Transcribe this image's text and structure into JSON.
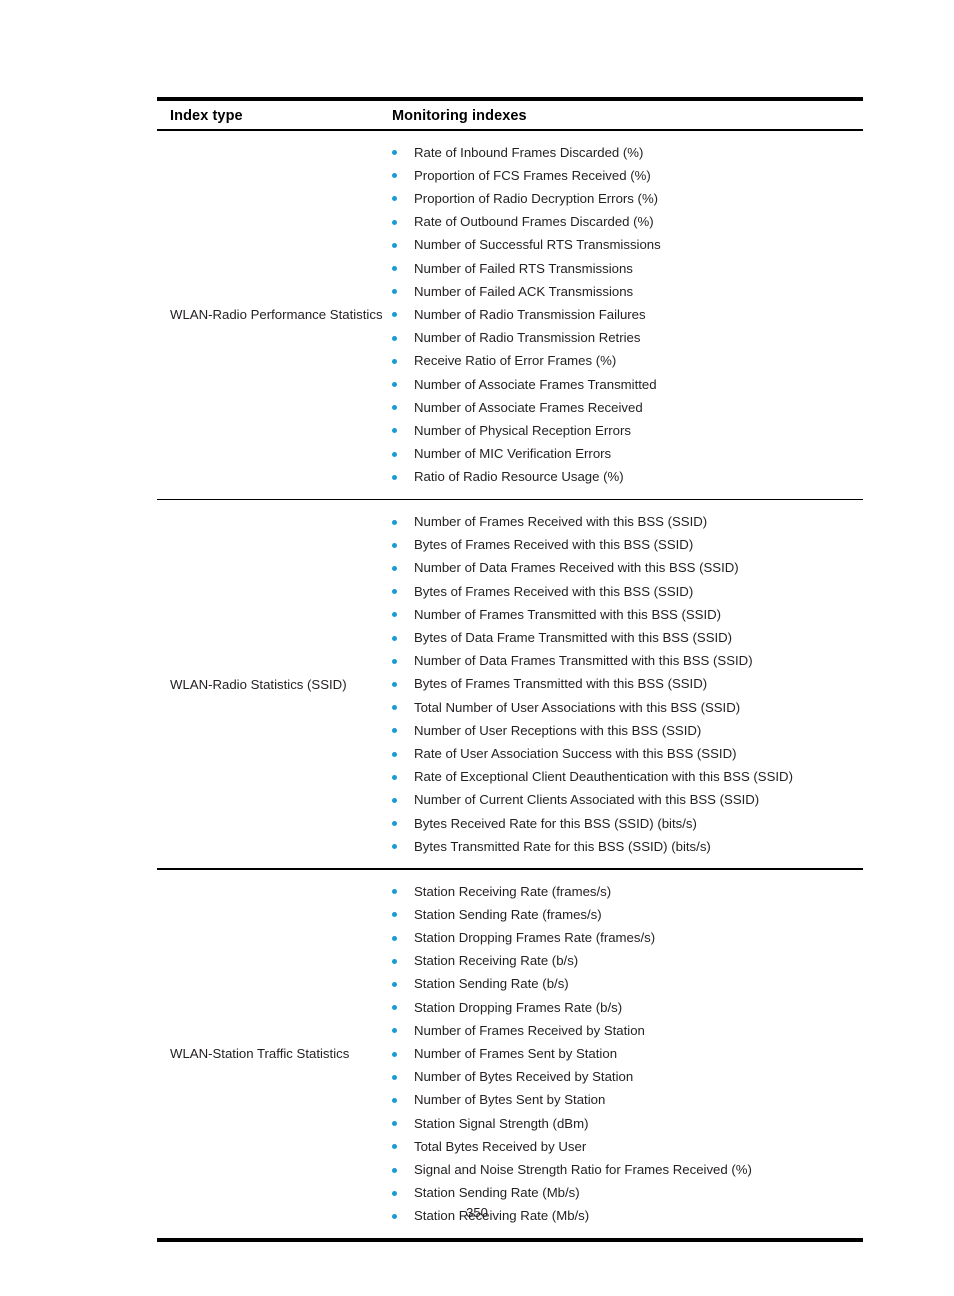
{
  "document": {
    "page_number": "350",
    "bullet_color": "#1b9ad6",
    "rule_color": "#000000"
  },
  "table": {
    "headers": {
      "index_type": "Index type",
      "monitoring_indexes": "Monitoring indexes"
    },
    "rows": [
      {
        "index_type": "WLAN-Radio Performance Statistics",
        "items": [
          "Rate of Inbound Frames Discarded (%)",
          "Proportion of FCS Frames Received (%)",
          "Proportion of Radio Decryption Errors (%)",
          "Rate of Outbound Frames Discarded (%)",
          "Number of Successful RTS Transmissions",
          "Number of Failed RTS Transmissions",
          "Number of Failed ACK Transmissions",
          "Number of Radio Transmission Failures",
          "Number of Radio Transmission Retries",
          "Receive Ratio of Error Frames (%)",
          "Number of Associate Frames Transmitted",
          "Number of Associate Frames Received",
          "Number of Physical Reception Errors",
          "Number of MIC Verification Errors",
          "Ratio of Radio Resource Usage (%)"
        ]
      },
      {
        "index_type": "WLAN-Radio Statistics (SSID)",
        "items": [
          "Number of Frames Received with this BSS (SSID)",
          "Bytes of Frames Received with this BSS (SSID)",
          "Number of Data Frames Received with this BSS (SSID)",
          "Bytes of Frames Received with this BSS (SSID)",
          "Number of Frames Transmitted with this BSS (SSID)",
          "Bytes of Data Frame Transmitted with this BSS (SSID)",
          "Number of Data Frames Transmitted with this BSS (SSID)",
          "Bytes of Frames Transmitted with this BSS (SSID)",
          "Total Number of User Associations with this BSS (SSID)",
          "Number of User Receptions with this BSS (SSID)",
          "Rate of User Association Success with this BSS (SSID)",
          "Rate of Exceptional Client Deauthentication with this BSS (SSID)",
          "Number of Current Clients Associated with this BSS (SSID)",
          "Bytes Received Rate for this BSS (SSID) (bits/s)",
          "Bytes Transmitted Rate for this BSS (SSID) (bits/s)"
        ]
      },
      {
        "index_type": "WLAN-Station Traffic Statistics",
        "items": [
          "Station Receiving Rate (frames/s)",
          "Station Sending Rate (frames/s)",
          "Station Dropping Frames Rate (frames/s)",
          "Station Receiving Rate (b/s)",
          "Station Sending Rate (b/s)",
          "Station Dropping Frames Rate (b/s)",
          "Number of Frames Received by Station",
          "Number of Frames Sent by Station",
          "Number of Bytes Received by Station",
          "Number of Bytes Sent by Station",
          "Station Signal Strength (dBm)",
          "Total Bytes Received by User",
          "Signal and Noise Strength Ratio for Frames Received (%)",
          "Station Sending Rate (Mb/s)",
          "Station Receiving Rate (Mb/s)"
        ]
      }
    ]
  }
}
